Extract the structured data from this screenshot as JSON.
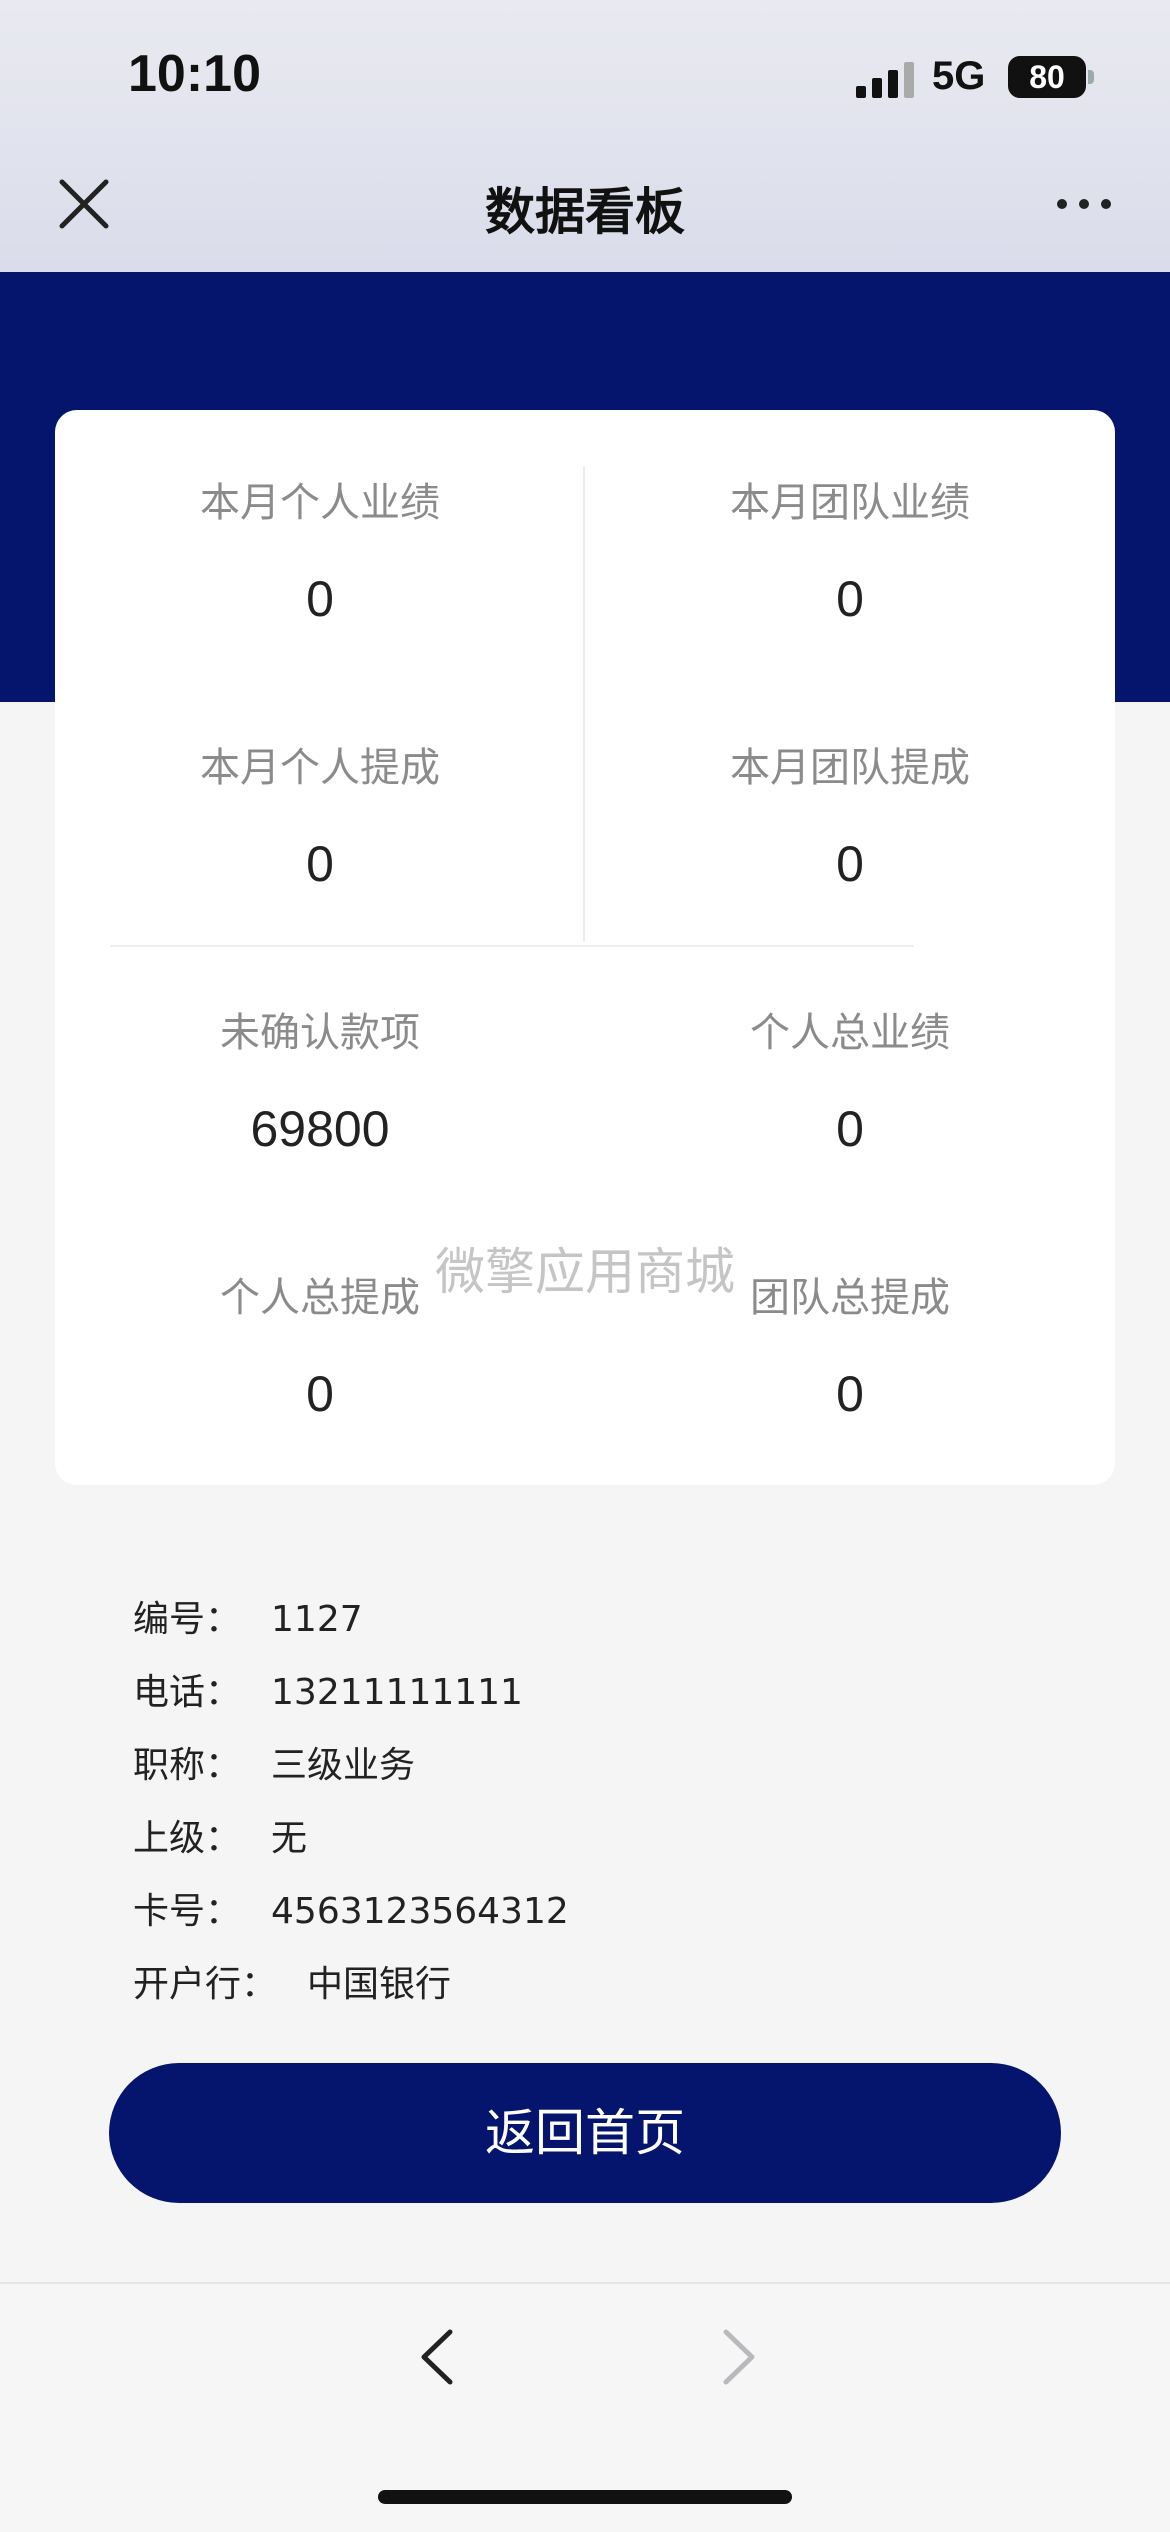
{
  "status_bar": {
    "time": "10:10",
    "network": "5G",
    "battery": "80"
  },
  "nav": {
    "title": "数据看板"
  },
  "stats": [
    {
      "label": "本月个人业绩",
      "value": "0"
    },
    {
      "label": "本月团队业绩",
      "value": "0"
    },
    {
      "label": "本月个人提成",
      "value": "0"
    },
    {
      "label": "本月团队提成",
      "value": "0"
    },
    {
      "label": "未确认款项",
      "value": "69800"
    },
    {
      "label": "个人总业绩",
      "value": "0"
    },
    {
      "label": "个人总提成",
      "value": "0"
    },
    {
      "label": "团队总提成",
      "value": "0"
    }
  ],
  "watermark": "微擎应用商城",
  "info": [
    {
      "label": "编号：",
      "value": "1127"
    },
    {
      "label": "电话：",
      "value": "13211111111"
    },
    {
      "label": "职称：",
      "value": "三级业务"
    },
    {
      "label": "上级：",
      "value": "无"
    },
    {
      "label": "卡号：",
      "value": "4563123564312"
    },
    {
      "label": "开户行：",
      "value": "中国银行"
    }
  ],
  "home_button": "返回首页",
  "colors": {
    "primary": "#05146c",
    "card": "#ffffff",
    "label": "#8b8b8b"
  }
}
